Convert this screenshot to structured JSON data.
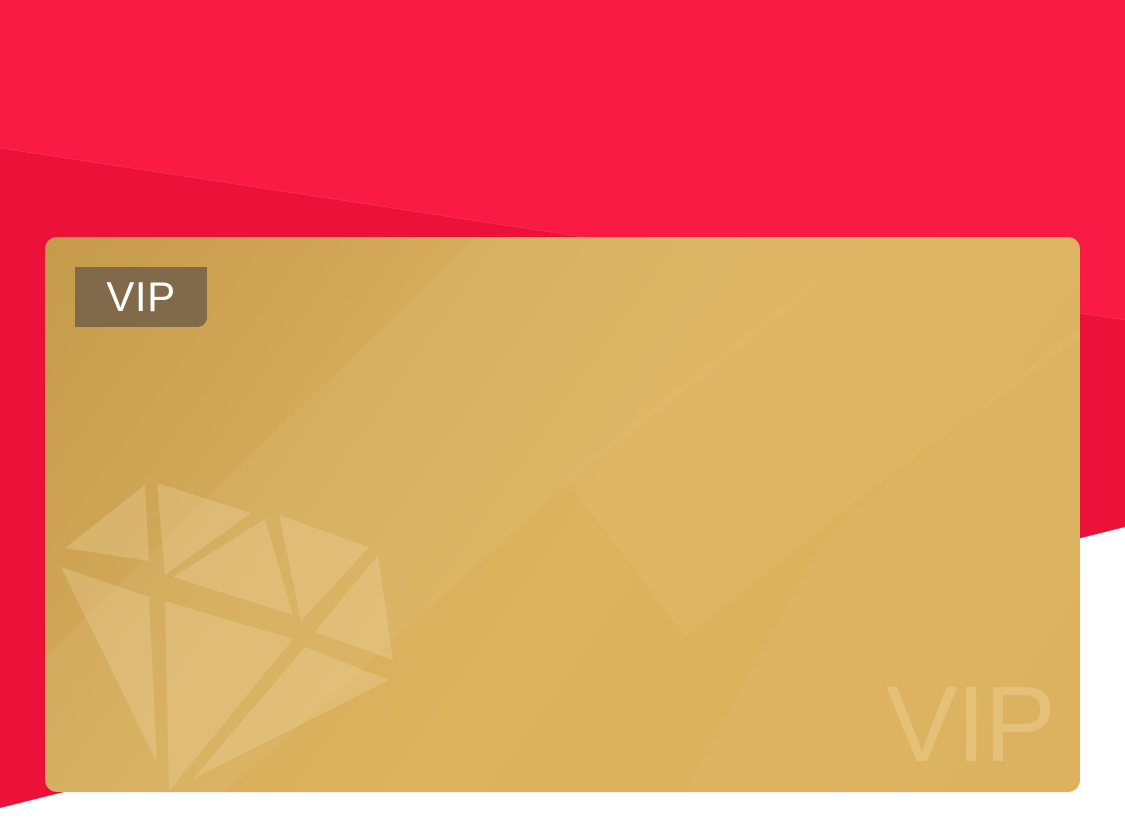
{
  "colors": {
    "background_red": "#f91b43",
    "background_red_dark": "#ec1139",
    "page_white": "#ffffff",
    "card_gold": "#d8ad5a",
    "badge_brown": "#806a4a"
  },
  "card": {
    "badge_label": "VIP",
    "watermark_text": "VIP",
    "emblem_icon": "diamond-icon"
  }
}
